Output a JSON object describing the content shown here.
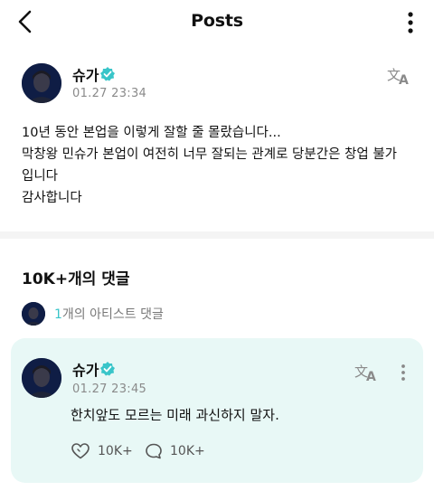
{
  "header": {
    "title": "Posts",
    "back_icon": "chevron-left-icon",
    "menu_icon": "more-vertical-icon"
  },
  "post": {
    "author": {
      "name": "슈가",
      "verified_color": "#39c5c9"
    },
    "timestamp": "01.27 23:34",
    "lines": [
      "10년 동안 본업을 이렇게 잘할 줄 몰랐습니다...",
      "막창왕 민슈가 본업이 여전히 너무 잘되는 관계로 당분간은 창업 불가",
      "입니다",
      "감사합니다"
    ]
  },
  "comments": {
    "title": "10K+개의 댓글",
    "artist_count": "1",
    "artist_label": "개의 아티스트 댓글"
  },
  "comment": {
    "author": {
      "name": "슈가"
    },
    "timestamp": "01.27 23:45",
    "text": "한치앞도 모르는 미래 과신하지 말자.",
    "likes": "10K+",
    "replies": "10K+",
    "card_color": "#e8f8f6"
  }
}
